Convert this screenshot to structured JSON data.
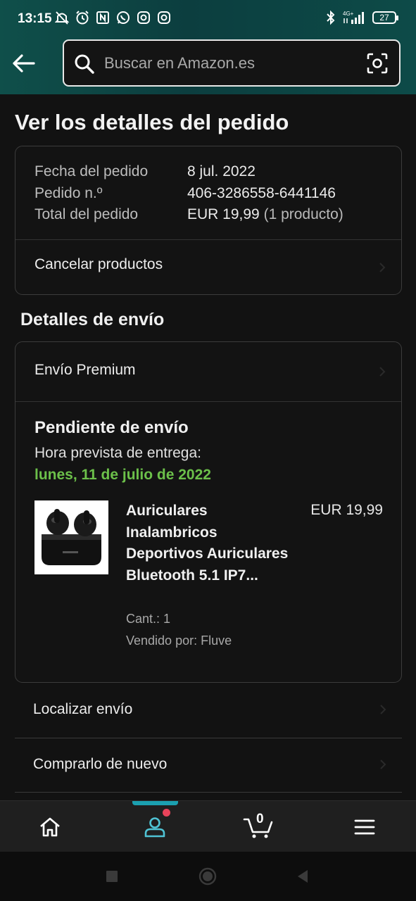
{
  "status_bar": {
    "time": "13:15",
    "network": "4G+",
    "battery": "27",
    "icons": [
      "mute-icon",
      "alarm-icon",
      "nfc-icon",
      "whatsapp-icon",
      "instagram-icon",
      "instagram-icon",
      "bluetooth-icon",
      "signal-icon",
      "battery-icon"
    ]
  },
  "header": {
    "search_placeholder": "Buscar en Amazon.es",
    "back_icon": "arrow-left-icon",
    "lens_icon": "camera-lens-icon"
  },
  "page": {
    "title": "Ver los detalles del pedido"
  },
  "order": {
    "date_label": "Fecha del pedido",
    "date_value": "8 jul. 2022",
    "number_label": "Pedido n.º",
    "number_value": "406-3286558-6441146",
    "total_label": "Total del pedido",
    "total_value": "EUR 19,99",
    "total_count": "(1 producto)",
    "cancel_label": "Cancelar productos"
  },
  "shipping": {
    "section_title": "Detalles de envío",
    "method": "Envío Premium",
    "status": "Pendiente de envío",
    "eta_label": "Hora prevista de entrega:",
    "eta_date": "lunes, 11 de julio de 2022",
    "accent_color": "#6cc04a"
  },
  "product": {
    "title": "Auriculares Inalambricos Deportivos Auriculares Bluetooth 5.1 IP7...",
    "price": "EUR 19,99",
    "quantity": "Cant.: 1",
    "seller": "Vendido por: Fluve",
    "image": "earbuds-product-image"
  },
  "actions": [
    {
      "label": "Localizar envío"
    },
    {
      "label": "Comprarlo de nuevo"
    }
  ],
  "bottom_nav": {
    "items": [
      "home-icon",
      "account-icon",
      "cart-icon",
      "menu-icon"
    ],
    "cart_count": "0",
    "active": "account-icon",
    "active_color": "#1ba0b0",
    "notification_color": "#e8435a"
  }
}
